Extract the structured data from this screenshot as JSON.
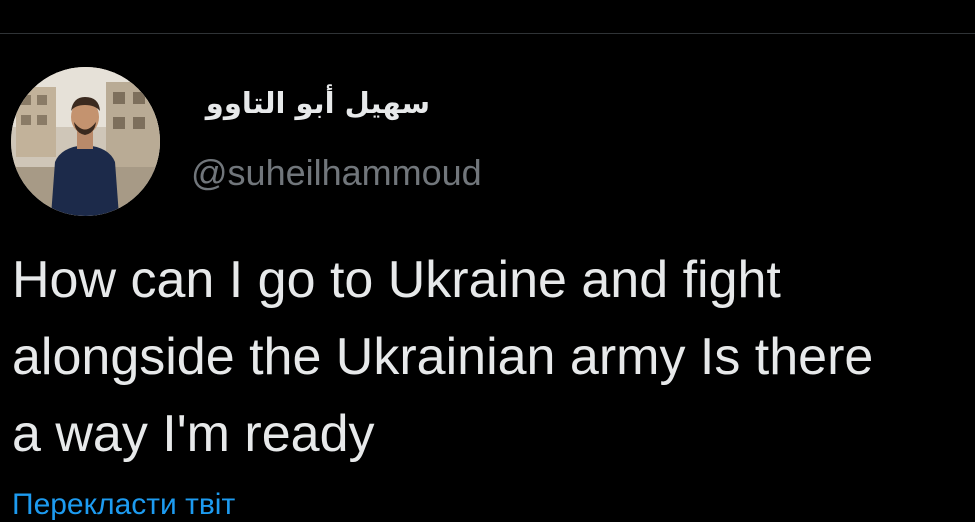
{
  "tweet": {
    "display_name": "سهيل أبو التاوو",
    "handle": "@suheilhammoud",
    "text_lines": [
      "How can I go to Ukraine and fight",
      "alongside the Ukrainian army Is there",
      "a way I'm ready"
    ],
    "translate_label": "Перекласти твіт"
  },
  "colors": {
    "background": "#000000",
    "text": "#e7e9ea",
    "secondary": "#71767b",
    "link": "#1d9bf0"
  },
  "icons": {
    "avatar": "profile-photo"
  }
}
